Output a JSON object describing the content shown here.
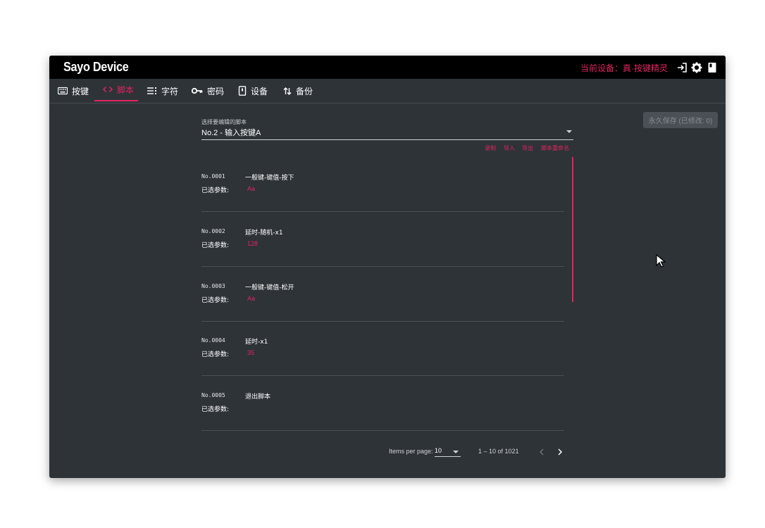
{
  "app": {
    "brand": "Sayo Device",
    "current_device": "当前设备：真·按键精灵"
  },
  "topbar_icons": [
    "login-icon",
    "gear-icon",
    "book-icon"
  ],
  "tabs": [
    {
      "label": "按键",
      "icon": "keyboard-icon",
      "active": false
    },
    {
      "label": "脚本",
      "icon": "code-icon",
      "active": true
    },
    {
      "label": "字符",
      "icon": "list-icon",
      "active": false
    },
    {
      "label": "密码",
      "icon": "key-icon",
      "active": false
    },
    {
      "label": "设备",
      "icon": "device-icon",
      "active": false
    },
    {
      "label": "备份",
      "icon": "swap-vertical-icon",
      "active": false
    }
  ],
  "save_button": {
    "label": "永久保存 (已修改: 0)"
  },
  "script_select": {
    "label": "选择要编辑的脚本",
    "value": "No.2 - 输入按键A"
  },
  "actions": [
    "录制",
    "导入",
    "导出",
    "脚本重命名"
  ],
  "script_items": [
    {
      "no": "No.0001",
      "name": "一般键-键值-按下",
      "param_label": "已选参数:",
      "param_value": "Aa"
    },
    {
      "no": "No.0002",
      "name": "延时-随机-x1",
      "param_label": "已选参数:",
      "param_value": "128"
    },
    {
      "no": "No.0003",
      "name": "一般键-键值-松开",
      "param_label": "已选参数:",
      "param_value": "Aa"
    },
    {
      "no": "No.0004",
      "name": "延时-x1",
      "param_label": "已选参数:",
      "param_value": "35"
    },
    {
      "no": "No.0005",
      "name": "退出脚本",
      "param_label": "已选参数:",
      "param_value": ""
    }
  ],
  "paginator": {
    "items_per_page_label": "Items per page:",
    "items_per_page": "10",
    "range": "1 – 10 of 1021"
  },
  "colors": {
    "accent": "#e0245e",
    "background": "#2e3338",
    "topbar": "#000000"
  }
}
